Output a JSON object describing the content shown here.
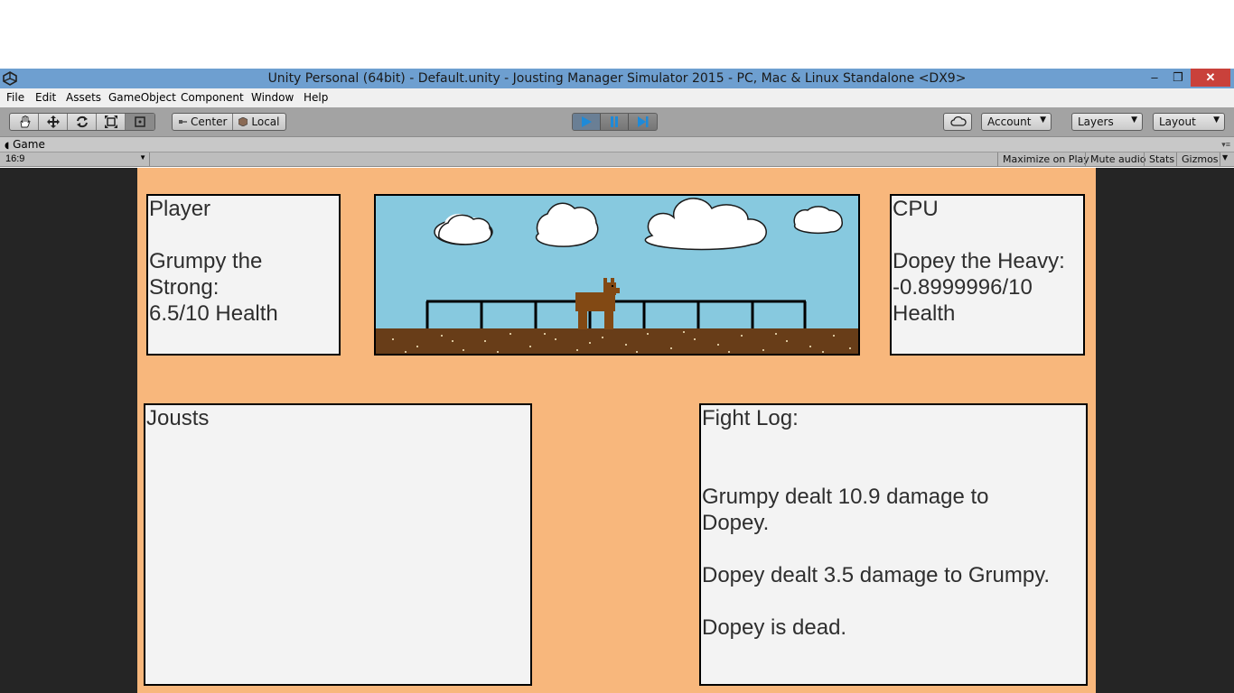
{
  "window": {
    "title": "Unity Personal (64bit) - Default.unity - Jousting Manager Simulator 2015 - PC, Mac & Linux Standalone <DX9>",
    "controls": {
      "minimize": "–",
      "restore": "❐",
      "close": "✕"
    }
  },
  "menu": [
    "File",
    "Edit",
    "Assets",
    "GameObject",
    "Component",
    "Window",
    "Help"
  ],
  "toolbar": {
    "tools": [
      "hand-icon",
      "move-icon",
      "rotate-icon",
      "scale-icon",
      "rect-icon"
    ],
    "pivot_label": "Center",
    "space_label": "Local",
    "play_state": "playing",
    "account_label": "Account",
    "layers_label": "Layers",
    "layout_label": "Layout"
  },
  "game_view": {
    "tab_label": "Game",
    "aspect": "16:9",
    "buttons": [
      "Maximize on Play",
      "Mute audio",
      "Stats",
      "Gizmos"
    ]
  },
  "game": {
    "player_panel": "Player\n\nGrumpy the\nStrong:\n6.5/10 Health",
    "cpu_panel": "CPU\n\nDopey the Heavy:\n-0.8999996/10\nHealth",
    "jousts_panel": "Jousts",
    "log_panel": "Fight Log:\n\n\nGrumpy dealt 10.9 damage to\nDopey.\n\nDopey dealt 3.5 damage to Grumpy.\n\nDopey is dead."
  },
  "colors": {
    "canvas_bg": "#f8b77c",
    "sky": "#87c9df",
    "ground": "#683d18",
    "horse": "#824914",
    "titlebar": "#6e9fd0"
  }
}
